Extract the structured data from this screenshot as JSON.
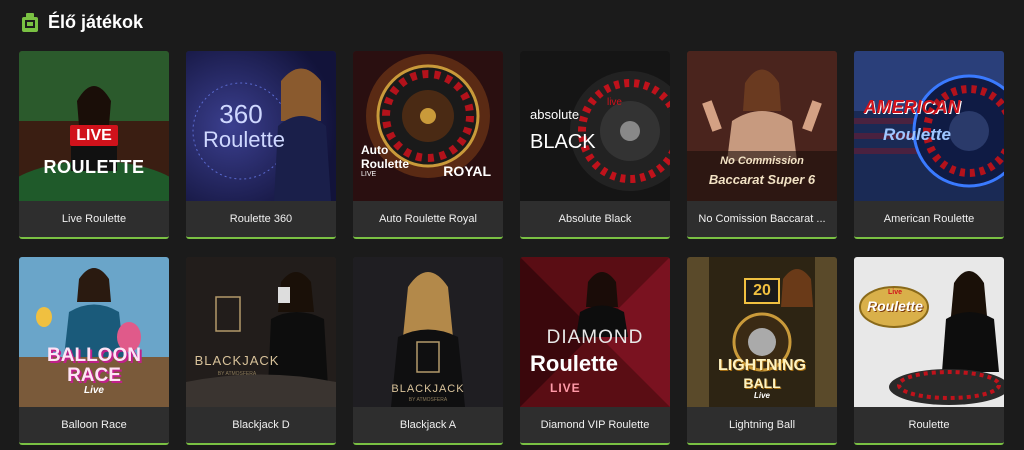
{
  "section": {
    "title": "Élő játékok",
    "icon": "live-cards-icon",
    "accent": "#7ac143"
  },
  "games": [
    {
      "label": "Live Roulette",
      "thumb_text": [
        "LIVE",
        "ROULETTE"
      ],
      "bg": "#3a1e12"
    },
    {
      "label": "Roulette 360",
      "thumb_text": [
        "360",
        "Roulette"
      ],
      "bg": "#1c1d4a"
    },
    {
      "label": "Auto Roulette Royal",
      "thumb_text": [
        "Auto",
        "Roulette",
        "LIVE",
        "ROYAL"
      ],
      "bg": "#2a0f10"
    },
    {
      "label": "Absolute Black",
      "thumb_text": [
        "live",
        "absolute",
        "BLACK"
      ],
      "bg": "#151515"
    },
    {
      "label": "No Comission Baccarat ...",
      "thumb_text": [
        "No Commission",
        "Baccarat Super 6"
      ],
      "bg": "#3b1f1a"
    },
    {
      "label": "American Roulette",
      "thumb_text": [
        "AMERICAN",
        "Roulette"
      ],
      "bg": "#1a2a55"
    },
    {
      "label": "Balloon Race",
      "thumb_text": [
        "BALLOON",
        "RACE",
        "Live"
      ],
      "bg": "#6aa5c9"
    },
    {
      "label": "Blackjack D",
      "thumb_text": [
        "BLACKJACK",
        "BY ATMOSFERA"
      ],
      "bg": "#2b2522"
    },
    {
      "label": "Blackjack A",
      "thumb_text": [
        "BLACKJACK",
        "BY ATMOSFERA"
      ],
      "bg": "#1f1e22"
    },
    {
      "label": "Diamond VIP Roulette",
      "thumb_text": [
        "DIAMOND",
        "Roulette",
        "LIVE"
      ],
      "bg": "#5a0d14"
    },
    {
      "label": "Lightning Ball",
      "thumb_text": [
        "20",
        "LIGHTNING",
        "BALL",
        "Live"
      ],
      "bg": "#2d2413"
    },
    {
      "label": "Roulette",
      "thumb_text": [
        "Live",
        "Roulette"
      ],
      "bg": "#e8e8e8"
    }
  ]
}
